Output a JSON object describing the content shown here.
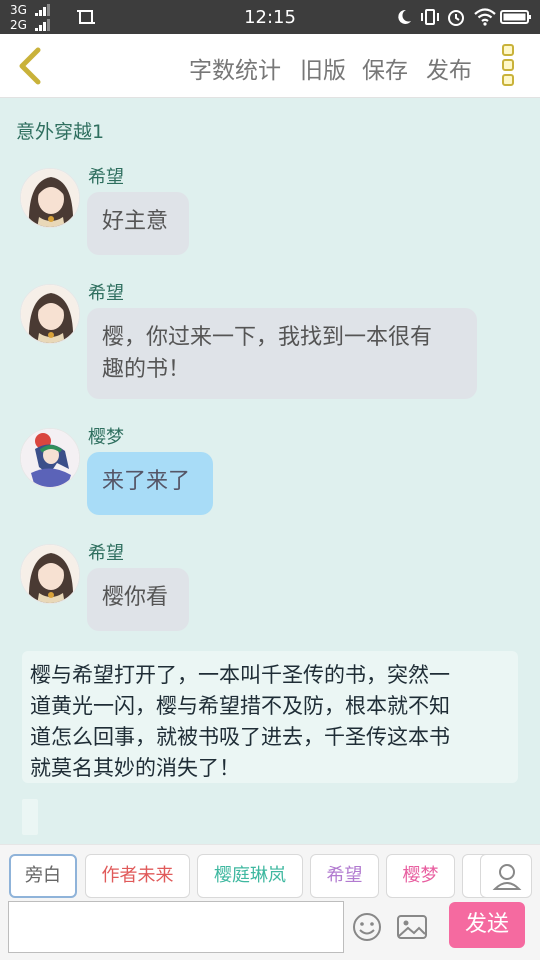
{
  "status_bar": {
    "network1": "3G",
    "network2": "2G",
    "time": "12:15"
  },
  "header": {
    "buttons": [
      "字数统计",
      "旧版",
      "保存",
      "发布"
    ]
  },
  "chapter_title": "意外穿越1",
  "messages": [
    {
      "name": "希望",
      "text": "好主意",
      "style": "gray"
    },
    {
      "name": "希望",
      "text_lines": [
        "樱，你过来一下，我找到一本很有",
        "趣的书！"
      ],
      "style": "gray"
    },
    {
      "name": "樱梦",
      "text": "来了来了",
      "style": "blue"
    },
    {
      "name": "希望",
      "text": "樱你看",
      "style": "gray"
    }
  ],
  "narration_lines": [
    "樱与希望打开了，一本叫千圣传的书，突然一",
    "道黄光一闪，樱与希望措不及防，根本就不知",
    "道怎么回事，就被书吸了进去，千圣传这本书",
    "就莫名其妙的消失了！"
  ],
  "roles": [
    {
      "label": "旁白",
      "color": "#666666"
    },
    {
      "label": "作者未来",
      "color": "#e05a5a"
    },
    {
      "label": "樱庭琳岚",
      "color": "#3fb8a0"
    },
    {
      "label": "希望",
      "color": "#b27bd0"
    },
    {
      "label": "樱梦",
      "color": "#e85fa0"
    }
  ],
  "input": {
    "value": "",
    "send_label": "发送"
  },
  "colors": {
    "accent_pink": "#f56aa0",
    "background": "#dff0ee",
    "bubble_gray": "#dfe3e8",
    "bubble_blue": "#a8dcf7"
  }
}
